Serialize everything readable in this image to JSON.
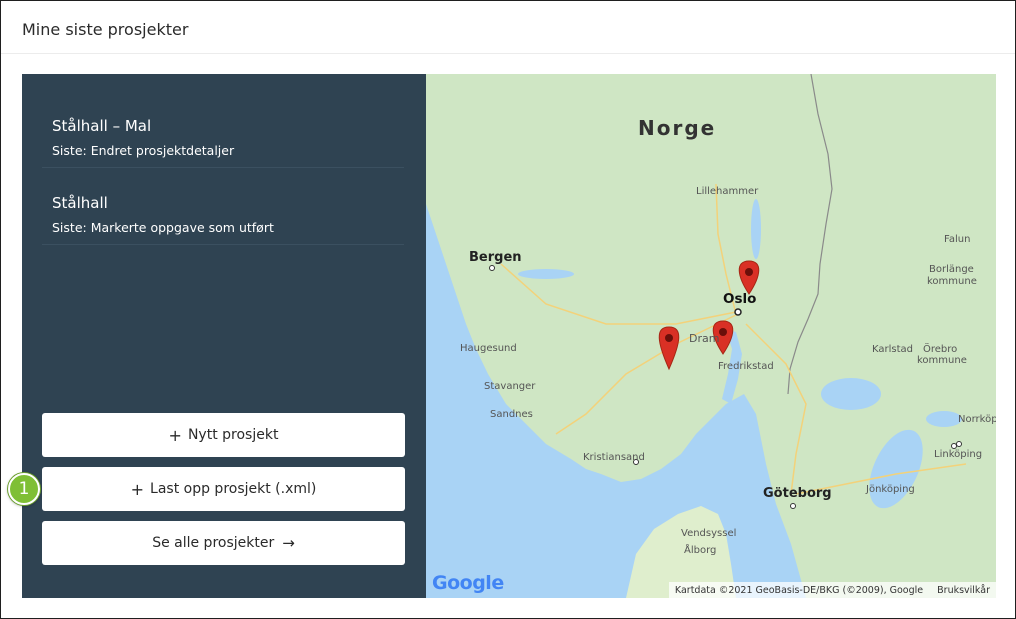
{
  "header": {
    "title": "Mine siste prosjekter"
  },
  "projects": [
    {
      "name": "Stålhall – Mal",
      "last": "Siste: Endret prosjektdetaljer"
    },
    {
      "name": "Stålhall",
      "last": "Siste: Markerte oppgave som utført"
    }
  ],
  "buttons": {
    "new_project": "Nytt prosjekt",
    "upload_project": "Last opp prosjekt (.xml)",
    "see_all": "Se alle prosjekter"
  },
  "badge": {
    "number": "1"
  },
  "map": {
    "country": "Norge",
    "places": {
      "lillehammer": "Lillehammer",
      "bergen": "Bergen",
      "falun": "Falun",
      "borlange": "Borlänge",
      "borlange_kommune": "kommune",
      "oslo": "Oslo",
      "drammen": "Dram",
      "haugesund": "Haugesund",
      "karlstad": "Karlstad",
      "orebro": "Örebro",
      "orebro_kommune": "kommune",
      "fredrikstad": "Fredrikstad",
      "stavanger": "Stavanger",
      "sandnes": "Sandnes",
      "norrkoping": "Norrköp",
      "kristiansand": "Kristiansand",
      "linkoping": "Linköping",
      "goteborg": "Göteborg",
      "jonkoping": "Jönköping",
      "vendsyssel": "Vendsyssel",
      "aalborg": "Ålborg"
    },
    "google_logo": "Google",
    "attribution": "Kartdata ©2021 GeoBasis-DE/BKG (©2009), Google",
    "terms": "Bruksvilkår"
  },
  "colors": {
    "panel_bg": "#2f4352",
    "badge": "#7fbf35",
    "marker": "#d93025",
    "water": "#a9d3f5",
    "land": "#cfe6c4"
  }
}
